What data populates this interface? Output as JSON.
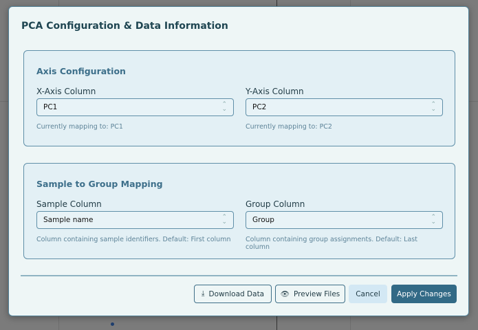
{
  "dialog": {
    "title": "PCA Configuration & Data Information"
  },
  "axis": {
    "title": "Axis Configuration",
    "x": {
      "label": "X-Axis Column",
      "value": "PC1",
      "hint": "Currently mapping to: PC1"
    },
    "y": {
      "label": "Y-Axis Column",
      "value": "PC2",
      "hint": "Currently mapping to: PC2"
    }
  },
  "mapping": {
    "title": "Sample to Group Mapping",
    "sample": {
      "label": "Sample Column",
      "value": "Sample name",
      "hint": "Column containing sample identifiers. Default: First column"
    },
    "group": {
      "label": "Group Column",
      "value": "Group",
      "hint": "Column containing group assignments. Default: Last column"
    }
  },
  "buttons": {
    "download": "Download Data",
    "preview": "Preview Files",
    "cancel": "Cancel",
    "apply": "Apply Changes"
  }
}
